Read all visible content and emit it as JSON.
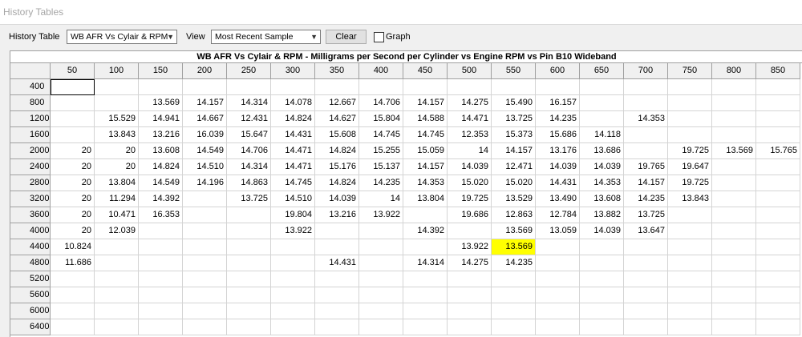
{
  "window": {
    "title": "History Tables"
  },
  "toolbar": {
    "history_table_label": "History Table",
    "history_table_value": "WB AFR Vs Cylair & RPM",
    "view_label": "View",
    "view_value": "Most Recent Sample",
    "clear_label": "Clear",
    "graph_label": "Graph",
    "graph_checked": false
  },
  "table": {
    "title": "WB AFR Vs Cylair & RPM - Milligrams per Second per Cylinder vs Engine RPM vs Pin B10 Wideband",
    "columns": [
      "50",
      "100",
      "150",
      "200",
      "250",
      "300",
      "350",
      "400",
      "450",
      "500",
      "550",
      "600",
      "650",
      "700",
      "750",
      "800",
      "850"
    ],
    "rows": [
      {
        "label": "400",
        "cells": [
          "",
          "",
          "",
          "",
          "",
          "",
          "",
          "",
          "",
          "",
          "",
          "",
          "",
          "",
          "",
          "",
          ""
        ]
      },
      {
        "label": "800",
        "cells": [
          "",
          "",
          "13.569",
          "14.157",
          "14.314",
          "14.078",
          "12.667",
          "14.706",
          "14.157",
          "14.275",
          "15.490",
          "16.157",
          "",
          "",
          "",
          "",
          ""
        ]
      },
      {
        "label": "1200",
        "cells": [
          "",
          "15.529",
          "14.941",
          "14.667",
          "12.431",
          "14.824",
          "14.627",
          "15.804",
          "14.588",
          "14.471",
          "13.725",
          "14.235",
          "",
          "14.353",
          "",
          "",
          ""
        ]
      },
      {
        "label": "1600",
        "cells": [
          "",
          "13.843",
          "13.216",
          "16.039",
          "15.647",
          "14.431",
          "15.608",
          "14.745",
          "14.745",
          "12.353",
          "15.373",
          "15.686",
          "14.118",
          "",
          "",
          "",
          ""
        ]
      },
      {
        "label": "2000",
        "cells": [
          "20",
          "20",
          "13.608",
          "14.549",
          "14.706",
          "14.471",
          "14.824",
          "15.255",
          "15.059",
          "14",
          "14.157",
          "13.176",
          "13.686",
          "",
          "19.725",
          "13.569",
          "15.765"
        ]
      },
      {
        "label": "2400",
        "cells": [
          "20",
          "20",
          "14.824",
          "14.510",
          "14.314",
          "14.471",
          "15.176",
          "15.137",
          "14.157",
          "14.039",
          "12.471",
          "14.039",
          "14.039",
          "19.765",
          "19.647",
          "",
          ""
        ]
      },
      {
        "label": "2800",
        "cells": [
          "20",
          "13.804",
          "14.549",
          "14.196",
          "14.863",
          "14.745",
          "14.824",
          "14.235",
          "14.353",
          "15.020",
          "15.020",
          "14.431",
          "14.353",
          "14.157",
          "19.725",
          "",
          ""
        ]
      },
      {
        "label": "3200",
        "cells": [
          "20",
          "11.294",
          "14.392",
          "",
          "13.725",
          "14.510",
          "14.039",
          "14",
          "13.804",
          "19.725",
          "13.529",
          "13.490",
          "13.608",
          "14.235",
          "13.843",
          "",
          ""
        ]
      },
      {
        "label": "3600",
        "cells": [
          "20",
          "10.471",
          "16.353",
          "",
          "",
          "19.804",
          "13.216",
          "13.922",
          "",
          "19.686",
          "12.863",
          "12.784",
          "13.882",
          "13.725",
          "",
          "",
          ""
        ]
      },
      {
        "label": "4000",
        "cells": [
          "20",
          "12.039",
          "",
          "",
          "",
          "13.922",
          "",
          "",
          "14.392",
          "",
          "13.569",
          "13.059",
          "14.039",
          "13.647",
          "",
          "",
          ""
        ]
      },
      {
        "label": "4400",
        "cells": [
          "10.824",
          "",
          "",
          "",
          "",
          "",
          "",
          "",
          "",
          "13.922",
          "13.569",
          "",
          "",
          "",
          "",
          "",
          ""
        ]
      },
      {
        "label": "4800",
        "cells": [
          "11.686",
          "",
          "",
          "",
          "",
          "",
          "14.431",
          "",
          "14.314",
          "14.275",
          "14.235",
          "",
          "",
          "",
          "",
          "",
          ""
        ]
      },
      {
        "label": "5200",
        "cells": [
          "",
          "",
          "",
          "",
          "",
          "",
          "",
          "",
          "",
          "",
          "",
          "",
          "",
          "",
          "",
          "",
          ""
        ]
      },
      {
        "label": "5600",
        "cells": [
          "",
          "",
          "",
          "",
          "",
          "",
          "",
          "",
          "",
          "",
          "",
          "",
          "",
          "",
          "",
          "",
          ""
        ]
      },
      {
        "label": "6000",
        "cells": [
          "",
          "",
          "",
          "",
          "",
          "",
          "",
          "",
          "",
          "",
          "",
          "",
          "",
          "",
          "",
          "",
          ""
        ]
      },
      {
        "label": "6400",
        "cells": [
          "",
          "",
          "",
          "",
          "",
          "",
          "",
          "",
          "",
          "",
          "",
          "",
          "",
          "",
          "",
          "",
          ""
        ]
      }
    ],
    "highlight": {
      "row": 10,
      "col": 10,
      "color": "#ffff00"
    },
    "selected": {
      "row": 0,
      "col": 0
    }
  }
}
